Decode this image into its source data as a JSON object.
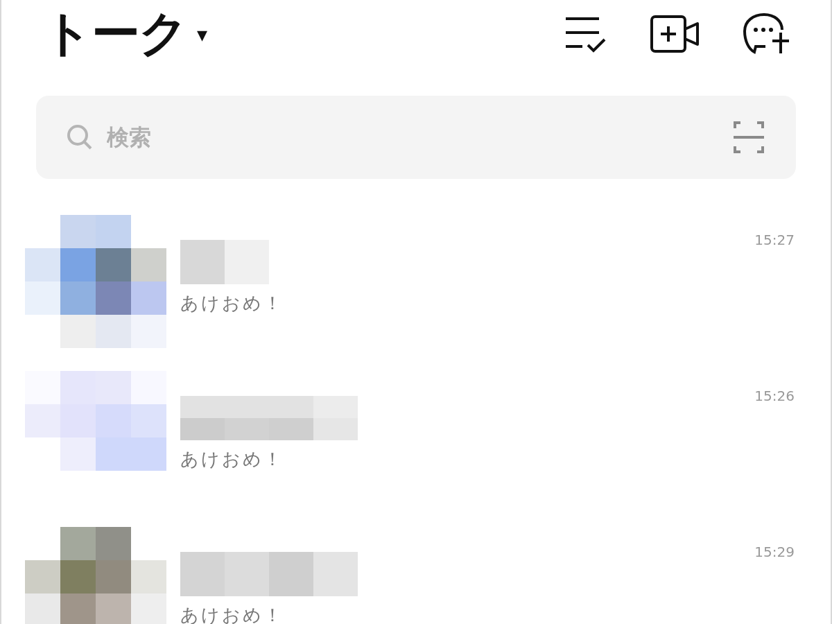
{
  "header": {
    "title": "トーク",
    "caret": "▾"
  },
  "search": {
    "placeholder": "検索"
  },
  "chats": [
    {
      "message": "あけおめ！",
      "time": "15:27"
    },
    {
      "message": "あけおめ！",
      "time": "15:26"
    },
    {
      "message": "あけおめ！",
      "time": "15:29"
    }
  ]
}
